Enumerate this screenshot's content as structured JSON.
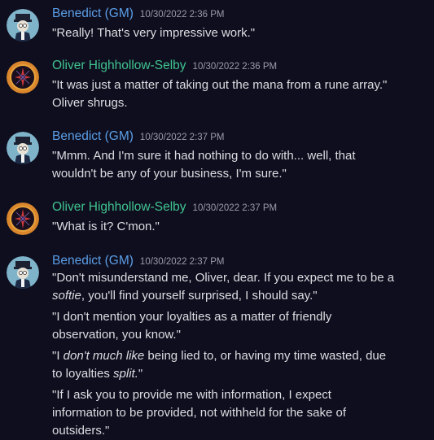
{
  "messages": [
    {
      "author": "Benedict (GM)",
      "timestamp": "10/30/2022 2:36 PM",
      "avatar": "gm-avatar-icon",
      "lines": [
        "\"Really! That's very impressive work.\""
      ]
    },
    {
      "author": "Oliver Highhollow-Selby",
      "timestamp": "10/30/2022 2:36 PM",
      "avatar": "oliver-avatar-icon",
      "lines": [
        "\"It was just a matter of taking out the mana from a rune array.\"",
        "Oliver shrugs."
      ]
    },
    {
      "author": "Benedict (GM)",
      "timestamp": "10/30/2022 2:37 PM",
      "avatar": "gm-avatar-icon",
      "lines": [
        "\"Mmm. And I'm sure it had nothing to do with... well, that",
        "wouldn't be any of your business, I'm sure.\""
      ]
    },
    {
      "author": "Oliver Highhollow-Selby",
      "timestamp": "10/30/2022 2:37 PM",
      "avatar": "oliver-avatar-icon",
      "lines": [
        "\"What is it? C'mon.\""
      ]
    },
    {
      "author": "Benedict (GM)",
      "timestamp": "10/30/2022 2:37 PM",
      "avatar": "gm-avatar-icon",
      "paragraphs": [
        {
          "l1": "\"Don't misunderstand me, Oliver, dear. If you expect me to be a",
          "l2_italic": "softie",
          "l2_rest": ", you'll find yourself surprised, I should say.\""
        },
        {
          "l1": "\"I don't mention your loyalties as a matter of friendly",
          "l2": "observation, you know.\""
        },
        {
          "l1_start": "\"I ",
          "l1_italic": "don't much like",
          "l1_rest": " being lied to, or having my time wasted, due",
          "l2_start": "to loyalties ",
          "l2_italic": "split.",
          "l2_rest": "\""
        },
        {
          "l1": "\"If I ask you to provide me with information, I expect",
          "l2": "information to be provided, not withheld for the sake of",
          "l3": "outsiders.\""
        }
      ]
    }
  ],
  "colors": {
    "background": "#0f0e1f",
    "gm_name": "#5b9ee6",
    "oliver_name": "#3fc48f",
    "text": "#dcdde1",
    "timestamp": "#9a9caa"
  }
}
